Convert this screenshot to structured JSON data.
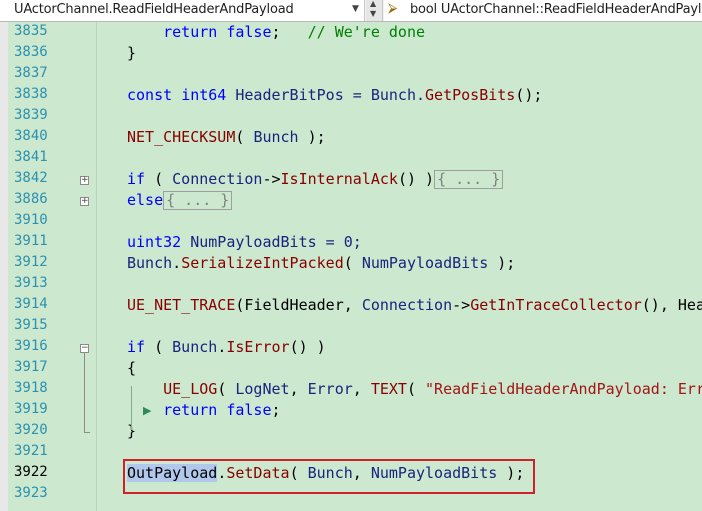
{
  "navbar": {
    "left_scope": "UActorChannel.ReadFieldHeaderAndPayload",
    "right_member": "bool UActorChannel::ReadFieldHeaderAndPayload",
    "dropdown_arrow": "▼",
    "split_up": "▲",
    "split_down": "▼",
    "member_icon": "⮚"
  },
  "lines": [
    {
      "num": "3835",
      "text": [
        {
          "t": "    ",
          "c": ""
        },
        {
          "t": "return",
          "c": "kw"
        },
        {
          "t": " ",
          "c": ""
        },
        {
          "t": "false",
          "c": "kw"
        },
        {
          "t": ";   ",
          "c": ""
        },
        {
          "t": "// We're done",
          "c": "cm"
        }
      ],
      "indent": 0
    },
    {
      "num": "3836",
      "text": [
        {
          "t": "}",
          "c": ""
        }
      ]
    },
    {
      "num": "3837",
      "text": []
    },
    {
      "num": "3838",
      "text": [
        {
          "t": "const",
          "c": "kw"
        },
        {
          "t": " ",
          "c": ""
        },
        {
          "t": "int64",
          "c": "ty"
        },
        {
          "t": " HeaderBitPos = Bunch.",
          "c": "id"
        },
        {
          "t": "GetPosBits",
          "c": "fn"
        },
        {
          "t": "();",
          "c": ""
        }
      ]
    },
    {
      "num": "3839",
      "text": []
    },
    {
      "num": "3840",
      "text": [
        {
          "t": "NET_CHECKSUM",
          "c": "fn"
        },
        {
          "t": "( ",
          "c": ""
        },
        {
          "t": "Bunch",
          "c": "id"
        },
        {
          "t": " );",
          "c": ""
        }
      ]
    },
    {
      "num": "3841",
      "text": []
    },
    {
      "num": "3842",
      "text": [
        {
          "t": "if",
          "c": "kw"
        },
        {
          "t": " ( ",
          "c": ""
        },
        {
          "t": "Connection",
          "c": "id"
        },
        {
          "t": "->",
          "c": ""
        },
        {
          "t": "IsInternalAck",
          "c": "fn"
        },
        {
          "t": "() )",
          "c": ""
        },
        {
          "t": "{ ... }",
          "c": "collapsed"
        }
      ]
    },
    {
      "num": "3886",
      "text": [
        {
          "t": "else",
          "c": "kw"
        },
        {
          "t": "{ ... }",
          "c": "collapsed"
        }
      ]
    },
    {
      "num": "3910",
      "text": []
    },
    {
      "num": "3911",
      "text": [
        {
          "t": "uint32",
          "c": "ty"
        },
        {
          "t": " NumPayloadBits = 0;",
          "c": "id"
        }
      ]
    },
    {
      "num": "3912",
      "text": [
        {
          "t": "Bunch",
          "c": "id"
        },
        {
          "t": ".",
          "c": ""
        },
        {
          "t": "SerializeIntPacked",
          "c": "fn"
        },
        {
          "t": "( ",
          "c": ""
        },
        {
          "t": "NumPayloadBits",
          "c": "id"
        },
        {
          "t": " );",
          "c": ""
        }
      ]
    },
    {
      "num": "3913",
      "text": []
    },
    {
      "num": "3914",
      "text": [
        {
          "t": "UE_NET_TRACE",
          "c": "fn"
        },
        {
          "t": "(FieldHeader, ",
          "c": ""
        },
        {
          "t": "Connection",
          "c": "id"
        },
        {
          "t": "->",
          "c": ""
        },
        {
          "t": "GetInTraceCollector",
          "c": "fn"
        },
        {
          "t": "(), Hea",
          "c": ""
        }
      ]
    },
    {
      "num": "3915",
      "text": []
    },
    {
      "num": "3916",
      "text": [
        {
          "t": "if",
          "c": "kw"
        },
        {
          "t": " ( ",
          "c": ""
        },
        {
          "t": "Bunch",
          "c": "id"
        },
        {
          "t": ".",
          "c": ""
        },
        {
          "t": "IsError",
          "c": "fn"
        },
        {
          "t": "() )",
          "c": ""
        }
      ]
    },
    {
      "num": "3917",
      "text": [
        {
          "t": "{",
          "c": ""
        }
      ]
    },
    {
      "num": "3918",
      "text": [
        {
          "t": "    ",
          "c": ""
        },
        {
          "t": "UE_LOG",
          "c": "fn"
        },
        {
          "t": "( ",
          "c": ""
        },
        {
          "t": "LogNet",
          "c": "id"
        },
        {
          "t": ", ",
          "c": ""
        },
        {
          "t": "Error",
          "c": "id"
        },
        {
          "t": ", ",
          "c": ""
        },
        {
          "t": "TEXT",
          "c": "fn"
        },
        {
          "t": "( ",
          "c": ""
        },
        {
          "t": "\"ReadFieldHeaderAndPayload: Err",
          "c": "st"
        }
      ]
    },
    {
      "num": "3919",
      "text": [
        {
          "t": "    ",
          "c": ""
        },
        {
          "t": "return",
          "c": "kw"
        },
        {
          "t": " ",
          "c": ""
        },
        {
          "t": "false",
          "c": "kw"
        },
        {
          "t": ";",
          "c": ""
        }
      ]
    },
    {
      "num": "3920",
      "text": [
        {
          "t": "}",
          "c": ""
        }
      ]
    },
    {
      "num": "3921",
      "text": []
    },
    {
      "num": "3922",
      "text": [
        {
          "t": "OutPayload",
          "c": "hl"
        },
        {
          "t": ".",
          "c": ""
        },
        {
          "t": "SetData",
          "c": "fn"
        },
        {
          "t": "( ",
          "c": ""
        },
        {
          "t": "Bunch",
          "c": "id"
        },
        {
          "t": ", ",
          "c": ""
        },
        {
          "t": "NumPayloadBits",
          "c": "id"
        },
        {
          "t": " );",
          "c": ""
        }
      ],
      "current": true
    },
    {
      "num": "3923",
      "text": []
    }
  ],
  "colors": {
    "editor_bg": "#cce8cf",
    "line_number": "#2b91af",
    "keyword": "#0000ff",
    "comment": "#008000",
    "string": "#a31515",
    "highlight_box": "#d0202a"
  }
}
